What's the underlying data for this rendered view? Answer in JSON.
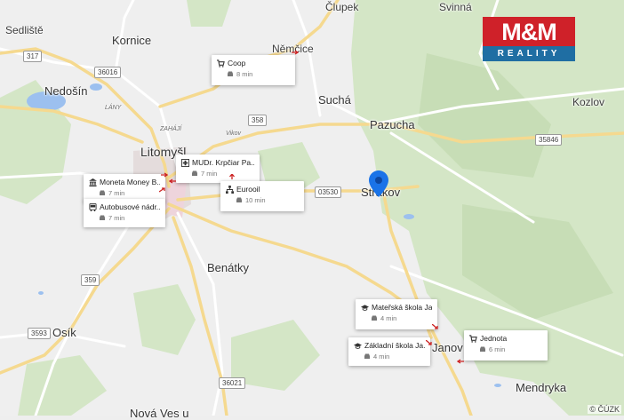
{
  "logo": {
    "top": "M&M",
    "bottom": "REALITY"
  },
  "copyright": "© ČÚZK",
  "places": [
    {
      "id": "sedliste",
      "label": "Sedliště"
    },
    {
      "id": "kornice",
      "label": "Kornice"
    },
    {
      "id": "clupek",
      "label": "Člupek"
    },
    {
      "id": "svinna",
      "label": "Svinná"
    },
    {
      "id": "nemcice",
      "label": "Němčice"
    },
    {
      "id": "nedosin",
      "label": "Nedošín"
    },
    {
      "id": "lany",
      "label": "LÁNY"
    },
    {
      "id": "zahaji",
      "label": "ZAHÁJÍ"
    },
    {
      "id": "vikov",
      "label": "Vikov"
    },
    {
      "id": "sucha",
      "label": "Suchá"
    },
    {
      "id": "kozlov",
      "label": "Kozlov"
    },
    {
      "id": "pazucha",
      "label": "Pazucha"
    },
    {
      "id": "litomysl",
      "label": "Litomyšl"
    },
    {
      "id": "strakov",
      "label": "Strakov"
    },
    {
      "id": "benatky",
      "label": "Benátky"
    },
    {
      "id": "osik",
      "label": "Osík"
    },
    {
      "id": "janov",
      "label": "Janov"
    },
    {
      "id": "mendryka",
      "label": "Mendryka"
    },
    {
      "id": "nova-ves",
      "label": "Nová Ves u"
    }
  ],
  "roads": [
    {
      "id": "r317",
      "label": "317"
    },
    {
      "id": "r36016",
      "label": "36016"
    },
    {
      "id": "r358",
      "label": "358"
    },
    {
      "id": "r35846",
      "label": "35846"
    },
    {
      "id": "r03530",
      "label": "03530"
    },
    {
      "id": "r359",
      "label": "359"
    },
    {
      "id": "r3593",
      "label": "3593"
    },
    {
      "id": "r36021",
      "label": "36021"
    }
  ],
  "pois": [
    {
      "id": "coop",
      "icon": "cart-icon",
      "name": "Coop",
      "time": "8 min"
    },
    {
      "id": "moneta",
      "icon": "bank-icon",
      "name": "Moneta Money B...",
      "time": "7 min"
    },
    {
      "id": "krpciar",
      "icon": "medical-cross-icon",
      "name": "MUDr. Krpčiar Pa...",
      "time": "7 min"
    },
    {
      "id": "eurooil",
      "icon": "fuel-network-icon",
      "name": "Eurooil",
      "time": "10 min"
    },
    {
      "id": "autobus",
      "icon": "bus-icon",
      "name": "Autobusové nádr...",
      "time": "7 min"
    },
    {
      "id": "materska",
      "icon": "graduation-cap-icon",
      "name": "Mateřská škola Ja...",
      "time": "4 min"
    },
    {
      "id": "zakladni",
      "icon": "graduation-cap-icon",
      "name": "Základní škola Ja...",
      "time": "4 min"
    },
    {
      "id": "jednota",
      "icon": "cart-icon",
      "name": "Jednota",
      "time": "6 min"
    }
  ],
  "colors": {
    "pin": "#1a73e8",
    "arrow": "#cc2222",
    "forest": "#cfe3c0",
    "water": "#8ab4f0",
    "road": "#f3d996"
  }
}
